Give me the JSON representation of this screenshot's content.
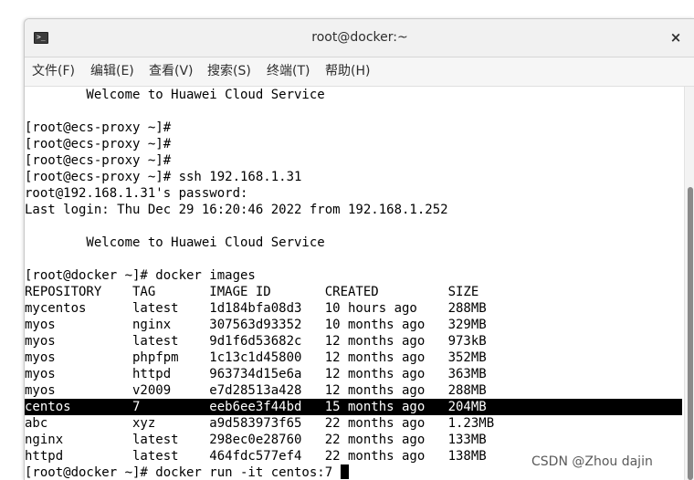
{
  "window": {
    "title": "root@docker:~",
    "close_label": "×",
    "icon_glyph": ">_"
  },
  "menu": [
    "文件(F)",
    "编辑(E)",
    "查看(V)",
    "搜索(S)",
    "终端(T)",
    "帮助(H)"
  ],
  "terminal": {
    "lines": [
      "        Welcome to Huawei Cloud Service",
      "",
      "[root@ecs-proxy ~]#",
      "[root@ecs-proxy ~]#",
      "[root@ecs-proxy ~]#",
      "[root@ecs-proxy ~]# ssh 192.168.1.31",
      "root@192.168.1.31's password:",
      "Last login: Thu Dec 29 16:20:46 2022 from 192.168.1.252",
      "",
      "        Welcome to Huawei Cloud Service",
      "",
      "[root@docker ~]# docker images",
      "REPOSITORY    TAG       IMAGE ID       CREATED         SIZE",
      "mycentos      latest    1d184bfa08d3   10 hours ago    288MB",
      "myos          nginx     307563d93352   10 months ago   329MB",
      "myos          latest    9d1f6d53682c   12 months ago   973kB",
      "myos          phpfpm    1c13c1d45800   12 months ago   352MB",
      "myos          httpd     963734d15e6a   12 months ago   363MB",
      "myos          v2009     e7d28513a428   12 months ago   288MB",
      "centos        7         eeb6ee3f44bd   15 months ago   204MB",
      "abc           xyz       a9d583973f65   22 months ago   1.23MB",
      "nginx         latest    298ec0e28760   22 months ago   133MB",
      "httpd         latest    464fdc577ef4   22 months ago   138MB",
      "[root@docker ~]# docker run -it centos:7 "
    ],
    "highlighted_line_index": 19,
    "cursor_line_index": 23
  },
  "watermark": "CSDN @Zhou dajin",
  "colors": {
    "terminal_bg": "#ffffff",
    "terminal_fg": "#000000",
    "highlight_bg": "#000000",
    "highlight_fg": "#ffffff"
  }
}
